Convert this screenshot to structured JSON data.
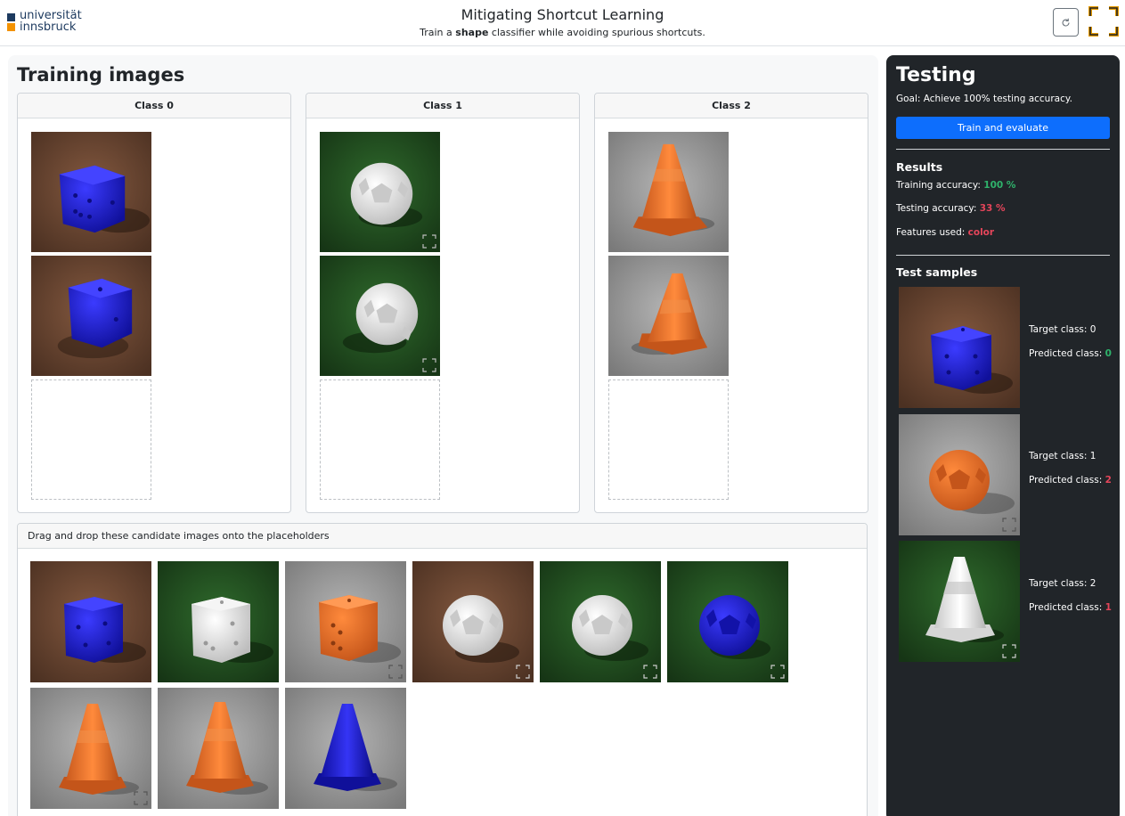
{
  "header": {
    "logo_line1": "universität",
    "logo_line2": "innsbruck",
    "title": "Mitigating Shortcut Learning",
    "subtitle_pre": "Train a ",
    "subtitle_bold": "shape",
    "subtitle_post": " classifier while avoiding spurious shortcuts.",
    "reload_icon": "reload-icon",
    "fullscreen_icon": "fullscreen-icon"
  },
  "training": {
    "title": "Training images",
    "classes": [
      {
        "label": "Class 0"
      },
      {
        "label": "Class 1"
      },
      {
        "label": "Class 2"
      }
    ]
  },
  "candidates": {
    "header": "Drag and drop these candidate images onto the placeholders"
  },
  "testing": {
    "title": "Testing",
    "goal": "Goal: Achieve 100% testing accuracy.",
    "button": "Train and evaluate",
    "results_title": "Results",
    "training_accuracy_label": "Training accuracy: ",
    "training_accuracy_value": "100 %",
    "testing_accuracy_label": "Testing accuracy: ",
    "testing_accuracy_value": "33 %",
    "features_label": "Features used: ",
    "features_value": "color",
    "samples_title": "Test samples",
    "samples": [
      {
        "target": "Target class: 0",
        "predicted_label": "Predicted class: ",
        "predicted_value": "0"
      },
      {
        "target": "Target class: 1",
        "predicted_label": "Predicted class: ",
        "predicted_value": "2"
      },
      {
        "target": "Target class: 2",
        "predicted_label": "Predicted class: ",
        "predicted_value": "1"
      }
    ]
  },
  "colors": {
    "accent": "#0d6efd",
    "success": "#2fb36b",
    "danger": "#e4455a",
    "dark_panel": "#212529",
    "blue_object": "#1a1ad6",
    "orange_object": "#e8702a",
    "white_object": "#e6e6e6",
    "soil": "#6e4a35",
    "grass": "#244d22",
    "asphalt": "#9a9a9a"
  }
}
